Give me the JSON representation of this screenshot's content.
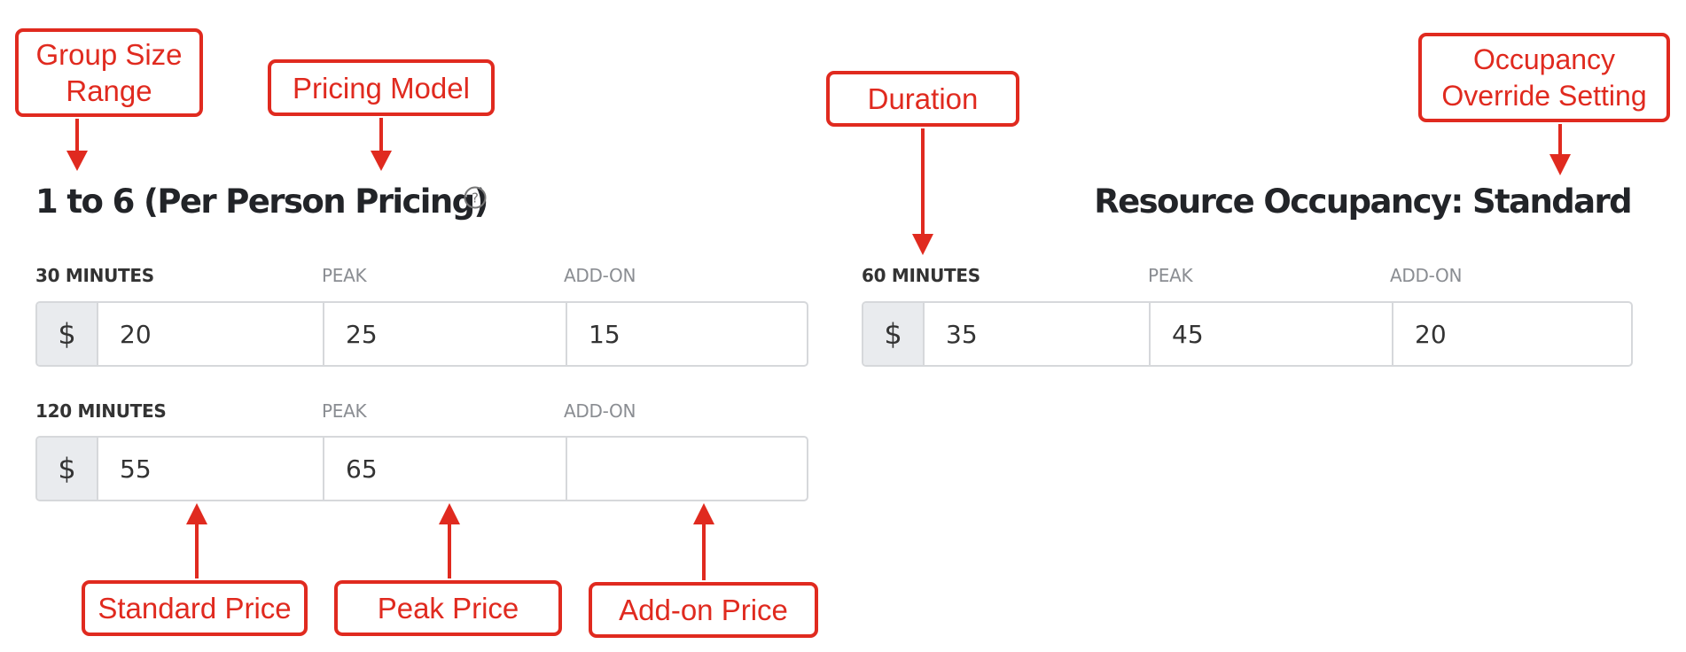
{
  "group": {
    "title": "1 to 6 (Per Person Pricing)",
    "help_icon": "question-circle-icon"
  },
  "occupancy": {
    "title": "Resource Occupancy: Standard"
  },
  "currency_symbol": "$",
  "tiers": [
    {
      "duration": "30 MINUTES",
      "peak_label": "PEAK",
      "addon_label": "ADD-ON",
      "standard": "20",
      "peak": "25",
      "addon": "15"
    },
    {
      "duration": "120 MINUTES",
      "peak_label": "PEAK",
      "addon_label": "ADD-ON",
      "standard": "55",
      "peak": "65",
      "addon": ""
    },
    {
      "duration": "60 MINUTES",
      "peak_label": "PEAK",
      "addon_label": "ADD-ON",
      "standard": "35",
      "peak": "45",
      "addon": "20"
    }
  ],
  "annotations": {
    "group_size_range": "Group Size Range",
    "pricing_model": "Pricing Model",
    "duration": "Duration",
    "occupancy_override": "Occupancy Override Setting",
    "standard_price": "Standard Price",
    "peak_price": "Peak Price",
    "addon_price": "Add-on Price"
  },
  "colors": {
    "annotation": "#e02a1f",
    "heading_text": "#222428",
    "label_muted": "#8a8d92",
    "border": "#d6d8db",
    "prefix_bg": "#e9ebee"
  }
}
